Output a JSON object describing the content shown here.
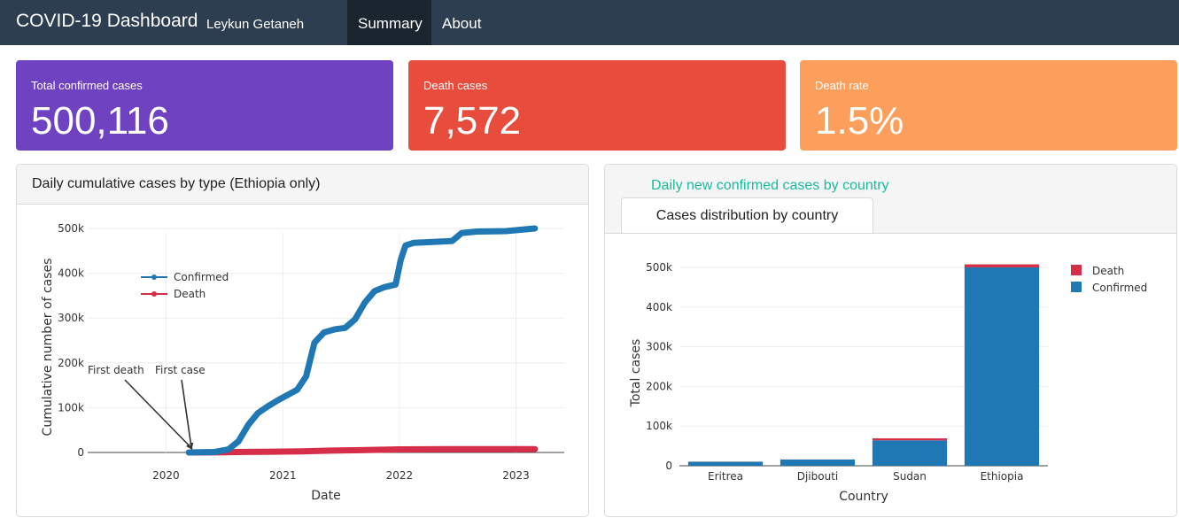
{
  "navbar": {
    "title": "COVID-19 Dashboard",
    "subtitle": "Leykun Getaneh",
    "tabs": [
      {
        "label": "Summary",
        "active": true
      },
      {
        "label": "About",
        "active": false
      }
    ]
  },
  "value_boxes": [
    {
      "label": "Total confirmed cases",
      "value": "500,116",
      "color": "#6f42c1"
    },
    {
      "label": "Death cases",
      "value": "7,572",
      "color": "#e74c3c"
    },
    {
      "label": "Death rate",
      "value": "1.5%",
      "color": "#fd9f5c"
    }
  ],
  "left_card": {
    "title": "Daily cumulative cases by type (Ethiopia only)"
  },
  "right_card": {
    "link_title": "Daily new confirmed cases by country",
    "active_tab": "Cases distribution by country"
  },
  "colors": {
    "confirmed": "#1f77b4",
    "death": "#d62d48"
  },
  "chart_data": [
    {
      "type": "line",
      "xlabel": "Date",
      "ylabel": "Cumulative number of cases",
      "x_ticks": [
        "2020",
        "2021",
        "2022",
        "2023"
      ],
      "y_ticks": [
        "0",
        "100k",
        "200k",
        "300k",
        "400k",
        "500k"
      ],
      "ylim": [
        0,
        500000
      ],
      "xlim": [
        "2019-05-01",
        "2023-06-01"
      ],
      "legend": {
        "placement": "top-left",
        "entries": [
          "Confirmed",
          "Death"
        ]
      },
      "grid": true,
      "series": [
        {
          "name": "Confirmed",
          "x": [
            "2020-03-13",
            "2020-06-01",
            "2020-07-15",
            "2020-08-15",
            "2020-09-15",
            "2020-10-15",
            "2020-11-15",
            "2020-12-15",
            "2021-01-15",
            "2021-02-15",
            "2021-03-15",
            "2021-04-10",
            "2021-05-10",
            "2021-06-15",
            "2021-07-15",
            "2021-08-15",
            "2021-09-15",
            "2021-10-15",
            "2021-11-15",
            "2021-12-20",
            "2022-01-05",
            "2022-01-20",
            "2022-02-15",
            "2022-04-15",
            "2022-06-15",
            "2022-07-15",
            "2022-09-01",
            "2022-12-01",
            "2023-01-15",
            "2023-03-01"
          ],
          "y": [
            0,
            1000,
            7000,
            25000,
            62000,
            88000,
            103000,
            116000,
            128000,
            140000,
            170000,
            245000,
            268000,
            275000,
            278000,
            297000,
            335000,
            360000,
            369000,
            375000,
            430000,
            462000,
            468000,
            470000,
            472000,
            490000,
            493000,
            494000,
            497000,
            500000
          ]
        },
        {
          "name": "Death",
          "x": [
            "2020-03-13",
            "2020-06-01",
            "2020-09-01",
            "2020-12-01",
            "2021-03-01",
            "2021-06-01",
            "2021-09-01",
            "2022-01-01",
            "2022-06-01",
            "2023-03-01"
          ],
          "y": [
            0,
            100,
            1100,
            1800,
            2400,
            4200,
            5200,
            7000,
            7500,
            7572
          ]
        }
      ],
      "annotations": [
        {
          "text": "First death",
          "x": "2020-04-01",
          "y": 0
        },
        {
          "text": "First case",
          "x": "2020-03-13",
          "y": 0
        }
      ]
    },
    {
      "type": "bar",
      "stacked": true,
      "xlabel": "Country",
      "ylabel": "Total cases",
      "categories": [
        "Eritrea",
        "Djibouti",
        "Sudan",
        "Ethiopia"
      ],
      "y_ticks": [
        "0",
        "100k",
        "200k",
        "300k",
        "400k",
        "500k"
      ],
      "ylim": [
        0,
        500000
      ],
      "legend": {
        "placement": "top-right",
        "entries": [
          "Death",
          "Confirmed"
        ]
      },
      "series": [
        {
          "name": "Confirmed",
          "values": [
            10189,
            15690,
            63993,
            500116
          ]
        },
        {
          "name": "Death",
          "values": [
            103,
            189,
            5046,
            7572
          ]
        }
      ]
    }
  ]
}
